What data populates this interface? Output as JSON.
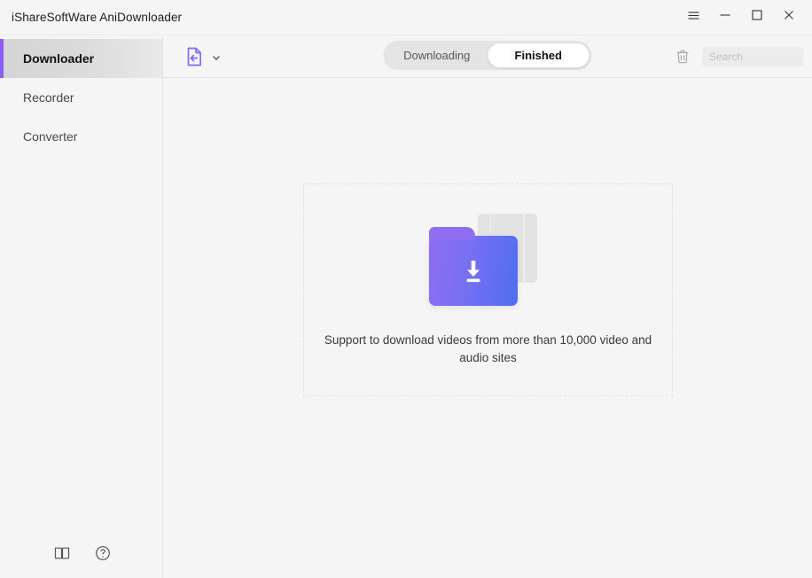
{
  "window": {
    "title": "iShareSoftWare AniDownloader",
    "controls": [
      {
        "name": "menu-button",
        "icon": "hamburger-icon"
      },
      {
        "name": "minimize-button",
        "icon": "minimize-icon"
      },
      {
        "name": "maximize-button",
        "icon": "maximize-icon"
      },
      {
        "name": "close-button",
        "icon": "close-icon"
      }
    ]
  },
  "sidebar": {
    "items": [
      {
        "label": "Downloader",
        "active": true
      },
      {
        "label": "Recorder",
        "active": false
      },
      {
        "label": "Converter",
        "active": false
      }
    ],
    "bottom_icons": [
      {
        "name": "guide-book-icon",
        "icon": "book-icon"
      },
      {
        "name": "help-icon",
        "icon": "question-circle-icon"
      }
    ]
  },
  "toolbar": {
    "paste_url_icon": "paste-document-icon",
    "paste_dropdown_icon": "chevron-down-icon",
    "tabs": [
      {
        "label": "Downloading",
        "active": false
      },
      {
        "label": "Finished",
        "active": true
      }
    ],
    "trash_icon": "trash-icon",
    "search_placeholder": "Search",
    "search_value": ""
  },
  "content": {
    "empty_state": {
      "illustration": "download-folder-illustration",
      "caption": "Support to download videos from more than 10,000 video and audio sites"
    }
  },
  "colors": {
    "accent_purple": "#8b5cf6",
    "folder_gradient_start": "#8f6ef2",
    "folder_gradient_end": "#4f6ef1",
    "window_bg": "#f5f5f5",
    "sidebar_active_bg": "#dcdcdc",
    "tab_track": "#e4e4e4"
  }
}
